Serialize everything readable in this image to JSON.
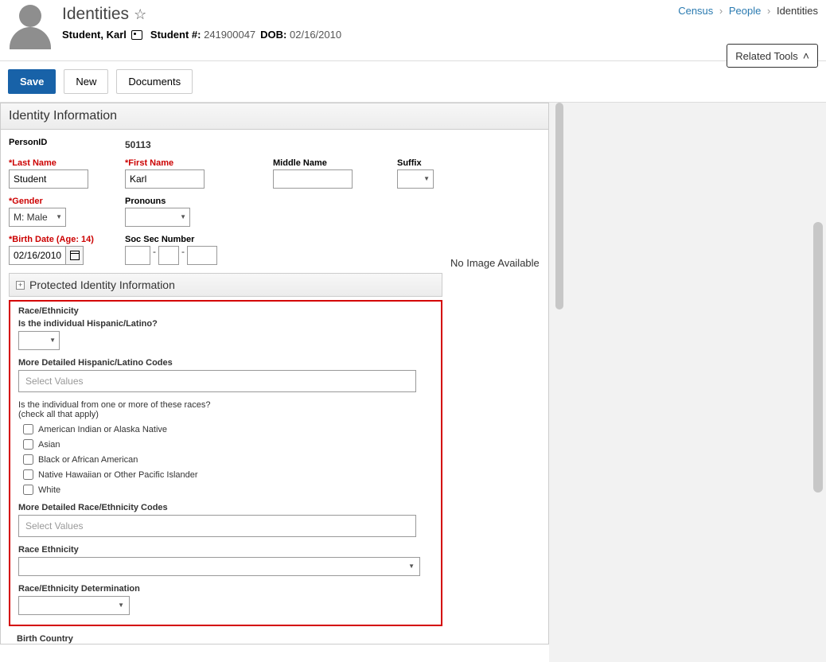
{
  "breadcrumb": {
    "census": "Census",
    "people": "People",
    "current": "Identities"
  },
  "header": {
    "title": "Identities",
    "related_tools": "Related Tools"
  },
  "student": {
    "name": "Student, Karl",
    "student_no_label": "Student #:",
    "student_no": "241900047",
    "dob_label": "DOB:",
    "dob": "02/16/2010"
  },
  "toolbar": {
    "save": "Save",
    "new": "New",
    "documents": "Documents"
  },
  "identity": {
    "section": "Identity Information",
    "person_id_label": "PersonID",
    "person_id": "50113",
    "last_name_label": "*Last Name",
    "last_name": "Student",
    "first_name_label": "*First Name",
    "first_name": "Karl",
    "middle_name_label": "Middle Name",
    "suffix_label": "Suffix",
    "gender_label": "*Gender",
    "gender": "M: Male",
    "pronouns_label": "Pronouns",
    "birth_date_label": "*Birth Date (Age: 14)",
    "birth_date": "02/16/2010",
    "ssn_label": "Soc Sec Number",
    "no_image": "No Image Available"
  },
  "protected": {
    "section": "Protected Identity Information"
  },
  "race": {
    "section": "Race/Ethnicity",
    "q_hispanic": "Is the individual Hispanic/Latino?",
    "detailed_hispanic": "More Detailed Hispanic/Latino Codes",
    "select_placeholder": "Select Values",
    "q_races": "Is the individual from one or more of these races?",
    "q_races_sub": "(check all that apply)",
    "options": {
      "aian": "American Indian or Alaska Native",
      "asian": "Asian",
      "black": "Black or African American",
      "nhpi": "Native Hawaiian or Other Pacific Islander",
      "white": "White"
    },
    "detailed_race": "More Detailed Race/Ethnicity Codes",
    "race_ethnicity": "Race Ethnicity",
    "determination": "Race/Ethnicity Determination"
  },
  "birth_country_label": "Birth Country"
}
